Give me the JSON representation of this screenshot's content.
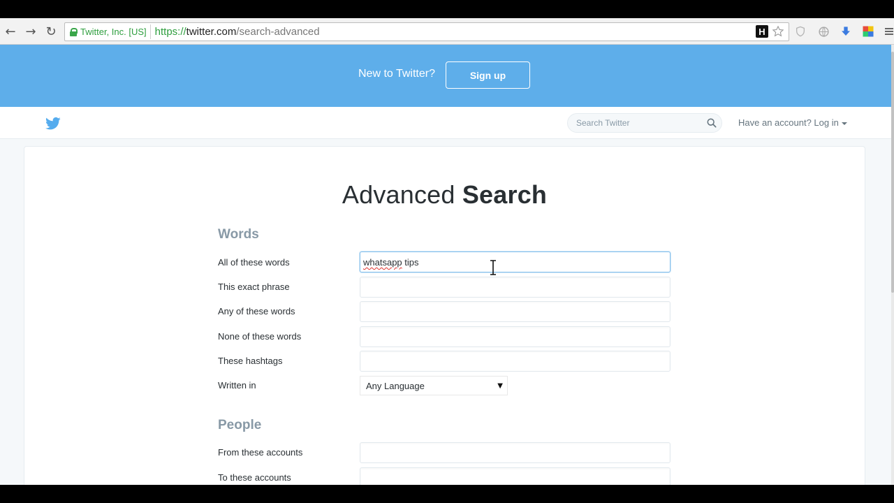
{
  "browser": {
    "ev_name": "Twitter, Inc. [US]",
    "url_scheme": "https://",
    "url_host": "twitter.com",
    "url_path": "/search-advanced",
    "extension_h_label": "H"
  },
  "banner": {
    "text": "New to Twitter?",
    "signup_label": "Sign up",
    "color": "#5eaeea"
  },
  "topbar": {
    "search_placeholder": "Search Twitter",
    "login_prefix": "Have an account?",
    "login_link": "Log in"
  },
  "page": {
    "title_light": "Advanced",
    "title_bold": "Search"
  },
  "sections": {
    "words": {
      "title": "Words",
      "all_label": "All of these words",
      "all_value_misspelled": "whatsapp",
      "all_value_rest": " tips",
      "exact_label": "This exact phrase",
      "any_label": "Any of these words",
      "none_label": "None of these words",
      "hashtags_label": "These hashtags",
      "language_label": "Written in",
      "language_value": "Any Language"
    },
    "people": {
      "title": "People",
      "from_label": "From these accounts",
      "to_label": "To these accounts"
    }
  },
  "icons": {
    "back": "back-arrow-icon",
    "forward": "forward-arrow-icon",
    "reload": "reload-icon",
    "star": "star-icon",
    "bird": "twitter-bird-icon",
    "search": "search-icon"
  },
  "colors": {
    "twitter_blue": "#55acee",
    "ev_green": "#2e9e3e"
  }
}
